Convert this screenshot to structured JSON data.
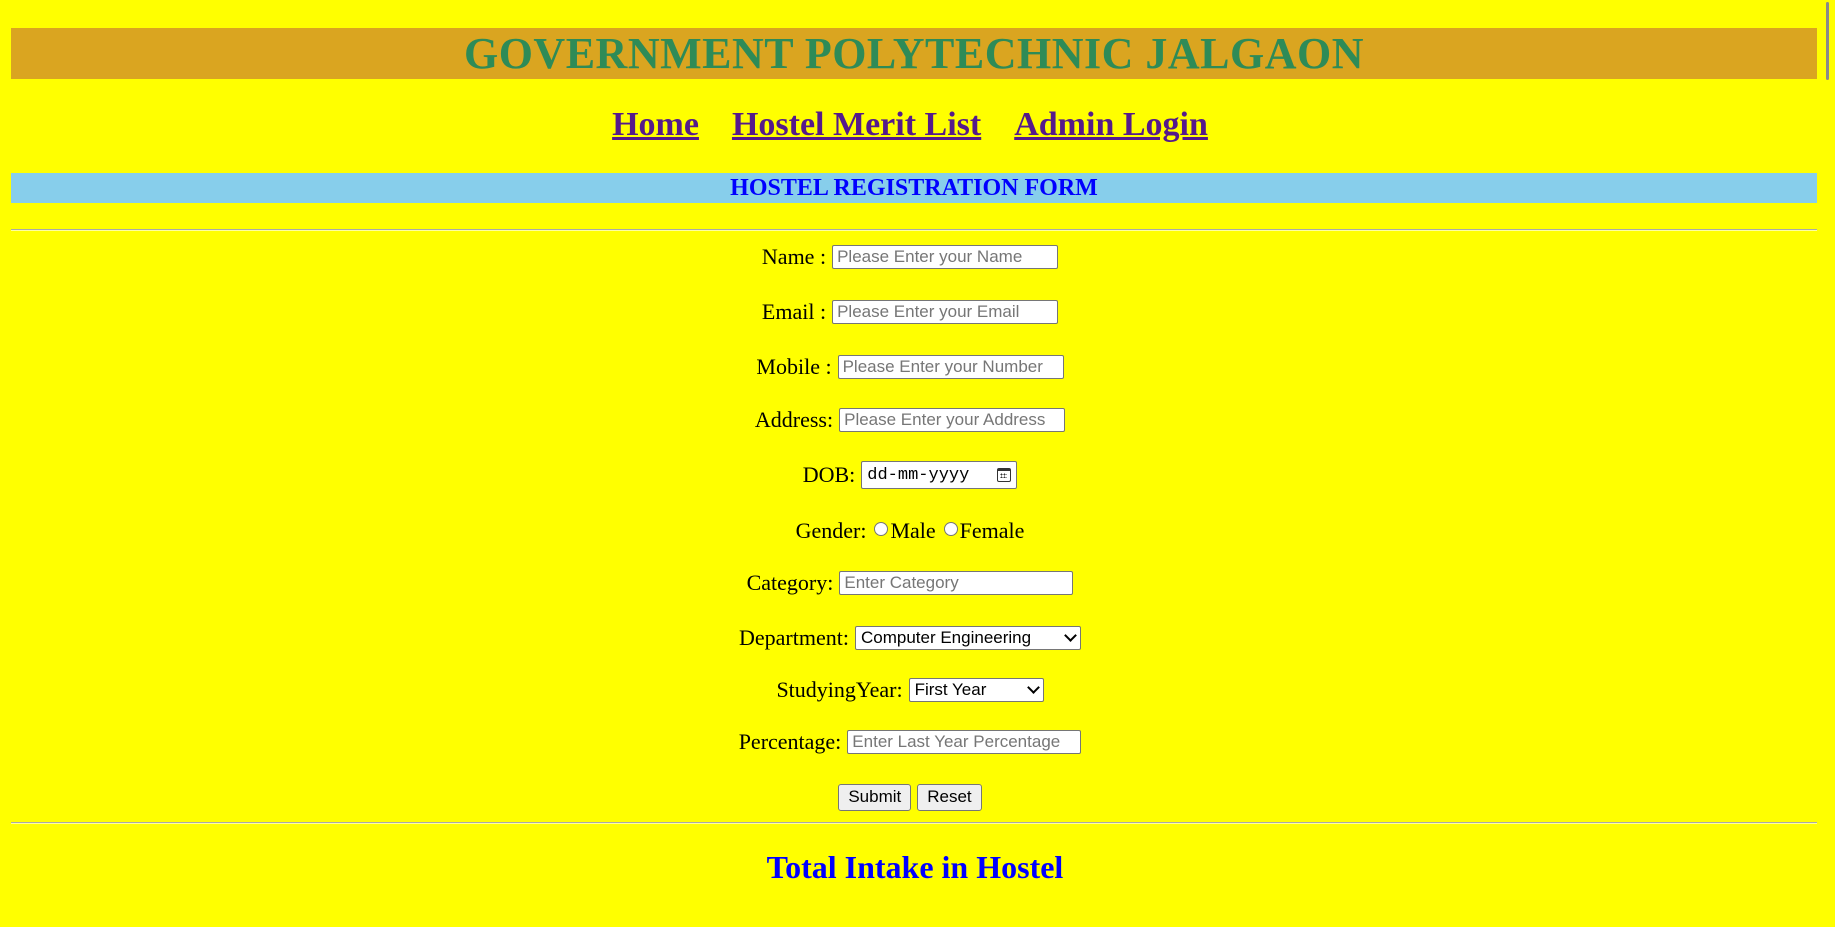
{
  "header": {
    "title": "GOVERNMENT POLYTECHNIC JALGAON"
  },
  "nav": {
    "items": [
      {
        "label": "Home"
      },
      {
        "label": "Hostel Merit List"
      },
      {
        "label": "Admin Login"
      }
    ]
  },
  "form": {
    "heading": "HOSTEL REGISTRATION FORM",
    "name": {
      "label": "Name :",
      "placeholder": "Please Enter your Name"
    },
    "email": {
      "label": "Email :",
      "placeholder": "Please Enter your Email"
    },
    "mobile": {
      "label": "Mobile :",
      "placeholder": "Please Enter your Number"
    },
    "address": {
      "label": "Address:",
      "placeholder": "Please Enter your Address"
    },
    "dob": {
      "label": "DOB:",
      "value": "dd-mm-yyyy"
    },
    "gender": {
      "label": "Gender:",
      "options": [
        "Male",
        "Female"
      ]
    },
    "category": {
      "label": "Category:",
      "placeholder": "Enter Category"
    },
    "department": {
      "label": "Department:",
      "selected": "Computer Engineering"
    },
    "studying_year": {
      "label": "StudyingYear:",
      "selected": "First Year"
    },
    "percentage": {
      "label": "Percentage:",
      "placeholder": "Enter Last Year Percentage"
    },
    "submit_label": "Submit",
    "reset_label": "Reset"
  },
  "intake": {
    "heading": "Total Intake in Hostel"
  },
  "colors": {
    "page_bg": "#ffff00",
    "title_bar": "#daa520",
    "title_text": "#2e8b57",
    "form_bar": "#87ceeb",
    "form_heading_text": "#0000ff",
    "link": "#551a8b"
  }
}
